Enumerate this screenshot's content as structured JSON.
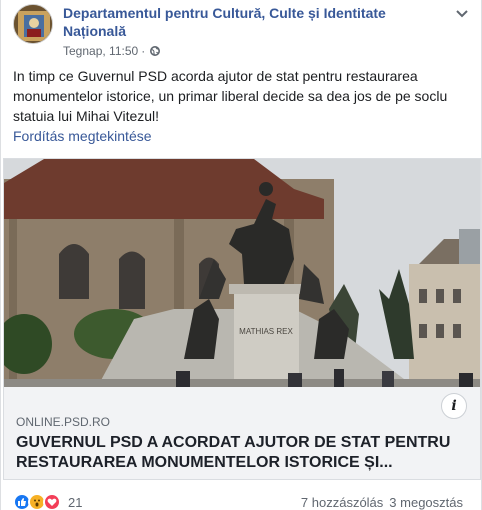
{
  "post": {
    "author": "Departamentul pentru Cultură, Culte și Identitate Națională",
    "timestamp": "Tegnap, 11:50",
    "privacy_icon": "globe-icon",
    "menu_icon": "chevron-down-icon",
    "body_text": "In timp ce Guvernul PSD acorda ajutor de stat pentru restaurarea monumentelor istorice, un primar liberal decide sa dea jos de pe soclu statuia lui Mihai Vitezul!",
    "translate_link": "Fordítás megtekintése"
  },
  "link_preview": {
    "domain": "ONLINE.PSD.RO",
    "headline": "GUVERNUL PSD A ACORDAT AJUTOR DE STAT PENTRU RESTAURAREA MONUMENTELOR ISTORICE ȘI...",
    "info_icon": "info-icon",
    "image_caption": "MATHIAS REX"
  },
  "footer": {
    "reaction_icons": [
      "like-icon",
      "wow-icon",
      "love-icon"
    ],
    "reaction_count": "21",
    "comments": "7 hozzászólás",
    "shares": "3 megosztás"
  },
  "colors": {
    "link": "#385898",
    "secondary_text": "#606770",
    "preview_bg": "#f2f3f5"
  }
}
